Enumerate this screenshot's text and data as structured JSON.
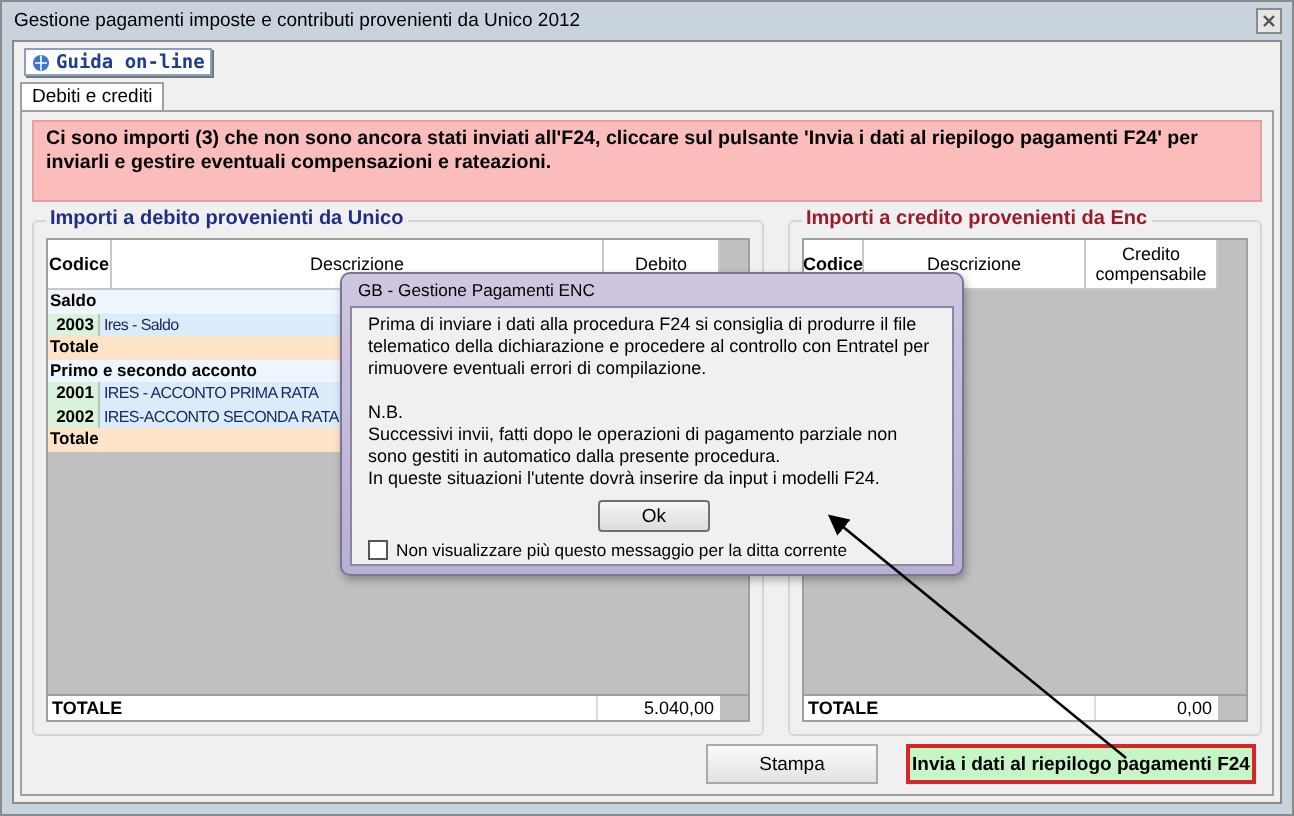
{
  "window": {
    "title": "Gestione pagamenti imposte e contributi provenienti da Unico 2012"
  },
  "toolbar": {
    "help_button": "Guida on-line"
  },
  "tabs": [
    {
      "label": "Debiti e crediti",
      "selected": true
    }
  ],
  "message": "Ci sono importi (3) che non sono ancora stati inviati all'F24, cliccare sul pulsante 'Invia i dati al riepilogo pagamenti F24' per inviarli e gestire eventuali compensazioni e rateazioni.",
  "debit_panel": {
    "title": "Importi a debito provenienti da Unico",
    "columns": [
      "Codice",
      "Descrizione",
      "Debito"
    ],
    "rows": [
      {
        "kind": "group",
        "label": "Saldo"
      },
      {
        "kind": "item",
        "code": "2003",
        "description": "Ires - Saldo"
      },
      {
        "kind": "total",
        "label": "Totale"
      },
      {
        "kind": "group",
        "label": "Primo e secondo acconto"
      },
      {
        "kind": "item",
        "code": "2001",
        "description": "IRES - ACCONTO PRIMA RATA"
      },
      {
        "kind": "item",
        "code": "2002",
        "description": "IRES-ACCONTO SECONDA RATA"
      },
      {
        "kind": "total",
        "label": "Totale"
      }
    ],
    "total_label": "TOTALE",
    "total_value": "5.040,00"
  },
  "credit_panel": {
    "title": "Importi a credito provenienti da Enc",
    "columns": [
      "Codice",
      "Descrizione",
      "Credito compensabile"
    ],
    "total_label": "TOTALE",
    "total_value": "0,00"
  },
  "buttons": [
    {
      "label": "Stampa",
      "kind": "normal"
    },
    {
      "label": "Invia i dati al riepilogo pagamenti F24",
      "kind": "primary"
    }
  ],
  "dialog": {
    "title": "GB - Gestione Pagamenti ENC",
    "paragraphs": [
      "Prima di inviare i dati alla procedura F24 si consiglia di produrre il file telematico della dichiarazione e procedere al controllo con Entratel per rimuovere eventuali errori di compilazione.",
      "N.B.",
      "Successivi invii, fatti dopo le operazioni di pagamento parziale non sono gestiti in automatico dalla presente procedura.",
      "In queste situazioni l'utente dovrà inserire da input i modelli F24."
    ],
    "ok_button": "Ok",
    "checkbox": {
      "label": "Non visualizzare più questo messaggio per la ditta corrente",
      "checked": false
    }
  }
}
